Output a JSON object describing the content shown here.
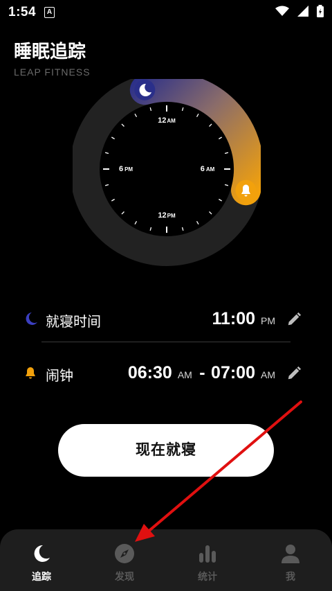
{
  "status_bar": {
    "time": "1:54",
    "notif_letter": "A"
  },
  "header": {
    "title": "睡眠追踪",
    "subtitle": "LEAP FITNESS"
  },
  "clock": {
    "label_top_num": "12",
    "label_top_unit": "AM",
    "label_right_num": "6",
    "label_right_unit": "AM",
    "label_bottom_num": "12",
    "label_bottom_unit": "PM",
    "label_left_num": "6",
    "label_left_unit": "PM",
    "colors": {
      "arc_start": "#2a2f8a",
      "arc_end": "#f2a10c",
      "ring": "#222222",
      "face": "#000000"
    }
  },
  "bedtime": {
    "label": "就寝时间",
    "time": "11:00",
    "period": "PM"
  },
  "alarm": {
    "label": "闹钟",
    "start": "06:30",
    "start_period": "AM",
    "separator": "-",
    "end": "07:00",
    "end_period": "AM"
  },
  "action": {
    "sleep_now_label": "现在就寝"
  },
  "nav": {
    "items": [
      {
        "label": "追踪",
        "icon": "moon-icon",
        "active": true
      },
      {
        "label": "发现",
        "icon": "compass-icon",
        "active": false
      },
      {
        "label": "统计",
        "icon": "bar-chart-icon",
        "active": false
      },
      {
        "label": "我",
        "icon": "person-icon",
        "active": false
      }
    ]
  }
}
